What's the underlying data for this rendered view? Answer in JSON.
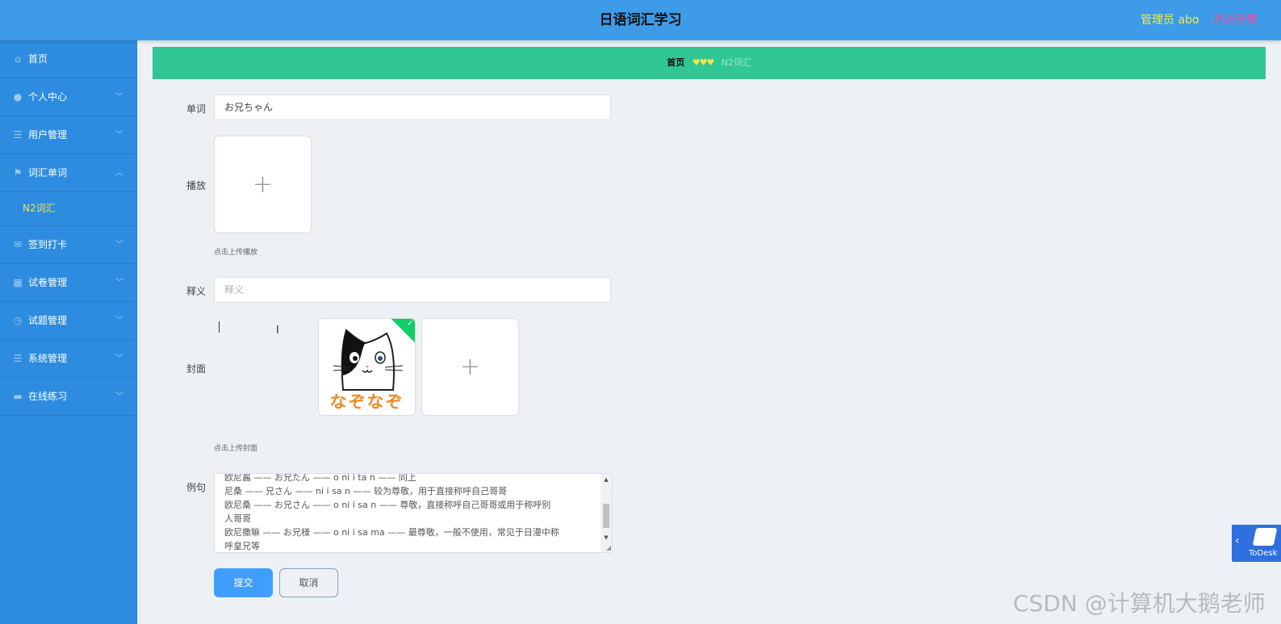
{
  "header": {
    "title": "日语词汇学习",
    "admin_label": "管理员 abo",
    "logout_label": "退出登录"
  },
  "sidebar": {
    "items": [
      {
        "label": "首页",
        "icon": "home-icon",
        "glyph": "⌂",
        "has_arrow": false
      },
      {
        "label": "个人中心",
        "icon": "user-icon",
        "glyph": "●",
        "has_arrow": true
      },
      {
        "label": "用户管理",
        "icon": "list-icon",
        "glyph": "☰",
        "has_arrow": true
      },
      {
        "label": "词汇单词",
        "icon": "flag-icon",
        "glyph": "⚑",
        "has_arrow": true,
        "expanded": true
      },
      {
        "label": "签到打卡",
        "icon": "mail-icon",
        "glyph": "✉",
        "has_arrow": true
      },
      {
        "label": "试卷管理",
        "icon": "grid-icon",
        "glyph": "▦",
        "has_arrow": true
      },
      {
        "label": "试题管理",
        "icon": "dashboard-icon",
        "glyph": "◷",
        "has_arrow": true
      },
      {
        "label": "系统管理",
        "icon": "list-icon",
        "glyph": "☰",
        "has_arrow": true
      },
      {
        "label": "在线练习",
        "icon": "monitor-icon",
        "glyph": "▬",
        "has_arrow": true
      }
    ],
    "submenu_label": "N2词汇"
  },
  "breadcrumb": {
    "home": "首页",
    "separator": "♥♥♥",
    "current": "N2词汇"
  },
  "form": {
    "word_label": "单词",
    "word_value": "お兄ちゃん",
    "play_label": "播放",
    "play_hint": "点击上传播放",
    "meaning_label": "释义",
    "meaning_placeholder": "释义",
    "cover_label": "封面",
    "cover_hint": "点击上传封面",
    "cover_image_text": "なぞなぞ",
    "example_label": "例句",
    "example_lines": [
      "欧尼酱 —— お兄たん —— o ni i ta n —— 同上",
      "尼桑 —— 兄さん —— ni i sa n —— 较为尊敬，用于直接称呼自己哥哥",
      "欧尼桑 —— お兄さん —— o ni i sa n —— 尊敬，直接称呼自己哥哥或用于称呼别",
      "人哥哥",
      "欧尼撒嘛 —— お兄様 —— o ni i sa ma —— 最尊敬，一般不使用，常见于日漫中称",
      "呼皇兄等"
    ],
    "submit_label": "提交",
    "cancel_label": "取消"
  },
  "widget": {
    "todesk_label": "ToDesk"
  },
  "watermark": "CSDN @计算机大鹅老师",
  "colors": {
    "header_bg": "#3d9be8",
    "sidebar_bg": "#2d8ce0",
    "breadcrumb_bg": "#30c795",
    "primary": "#409eff",
    "highlight": "#f2e44a",
    "logout": "#e0529a"
  }
}
